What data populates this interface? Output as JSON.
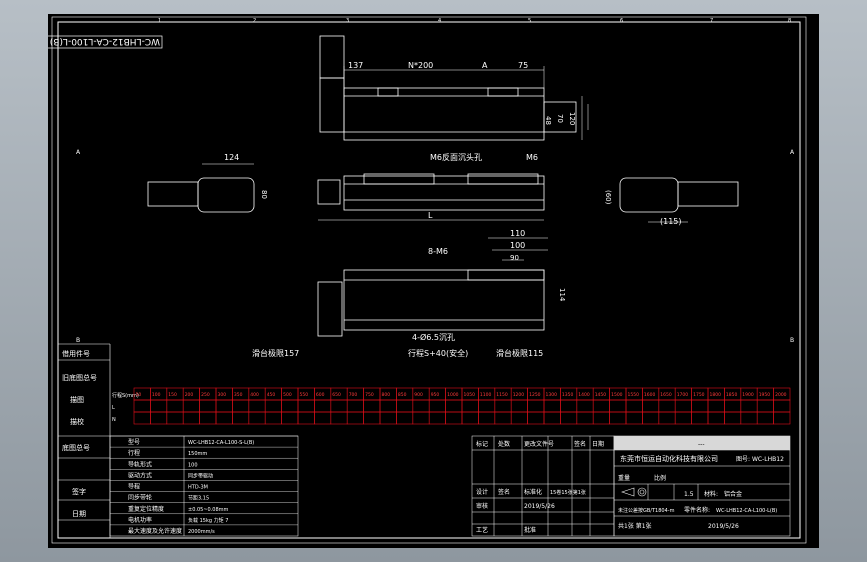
{
  "title_block_code": "WC-LHB12-CA-L100-L(B)",
  "grid_letters": {
    "a": "A",
    "b": "B"
  },
  "grid_numbers": [
    "1",
    "2",
    "3",
    "4",
    "5",
    "6",
    "7",
    "8"
  ],
  "dims": {
    "d137": "137",
    "d200": "N*200",
    "dA": "A",
    "d75": "75",
    "d48": "48",
    "d70": "70",
    "d120": "120",
    "d124": "124",
    "d80": "80",
    "d60": "(60)",
    "d115": "(115)",
    "dL": "L",
    "d110": "110",
    "d100": "100",
    "d90": "90",
    "d114": "114",
    "m6_back": "M6反面沉头孔",
    "m6": "M6",
    "b_m6": "8-M6",
    "holes": "4-Ø6.5沉孔",
    "stroke_left": "滑台极限157",
    "stroke_mid": "行程S+40(安全)",
    "stroke_right": "滑台极限115"
  },
  "side_labels": {
    "s1": "借用件号",
    "s2": "旧底图总号",
    "s3": "描图",
    "s4": "描校",
    "s5": "底图总号",
    "s6": "签字",
    "s7": "日期"
  },
  "stroke_table": {
    "row1": "行程S(mm)",
    "row2": "L",
    "row3": "N",
    "strokes": [
      "50",
      "100",
      "150",
      "200",
      "250",
      "300",
      "350",
      "400",
      "450",
      "500",
      "550",
      "600",
      "650",
      "700",
      "750",
      "800",
      "850",
      "900",
      "950",
      "1000",
      "1050",
      "1100",
      "1150",
      "1200",
      "1250",
      "1300",
      "1350",
      "1400",
      "1450",
      "1500",
      "1550",
      "1600",
      "1650",
      "1700",
      "1750",
      "1800",
      "1850",
      "1900",
      "1950",
      "2000"
    ]
  },
  "spec_table": {
    "labels": [
      "型号",
      "行程",
      "导轨形式",
      "驱动方式",
      "导程",
      "同步带轮",
      "重复定位精度",
      "电机功率",
      "最大速度及允许速度"
    ],
    "values": [
      "WC-LHB12-CA-L100-S-L(B)",
      "150mm",
      "100",
      "同步带驱动",
      "HTD-3M",
      "节距3,15",
      "±0.05~0.08mm",
      "负载 15kg 力矩 7",
      "2000mm/s"
    ]
  },
  "rev_table": {
    "headers": [
      "标记",
      "处数",
      "更改文件号",
      "签名",
      "日期"
    ],
    "rows": [
      [
        "设计",
        "签名",
        "标准化",
        "",
        "15卷15张第1张"
      ],
      [
        "审核",
        "",
        "",
        "",
        ""
      ],
      [
        "工艺",
        "",
        "批准",
        "",
        ""
      ]
    ],
    "date": "2019/5/26"
  },
  "company": {
    "name": "东莞市恒运自动化科技有限公司",
    "drawing_no_label": "图号:",
    "drawing_no": "WC-LHB12",
    "scale_label": "比例",
    "scale": "1.5",
    "weight_label": "重量",
    "material_label": "材料:",
    "material": "铝合金",
    "part_label": "零件名称:",
    "part": "WC-LHB12-CA-L100-L(B)",
    "sheet_label": "共1张 第1张",
    "date": "2019/5/26",
    "tolerance": "未注公差按GB/T1804-m",
    "top_cell": "---"
  }
}
